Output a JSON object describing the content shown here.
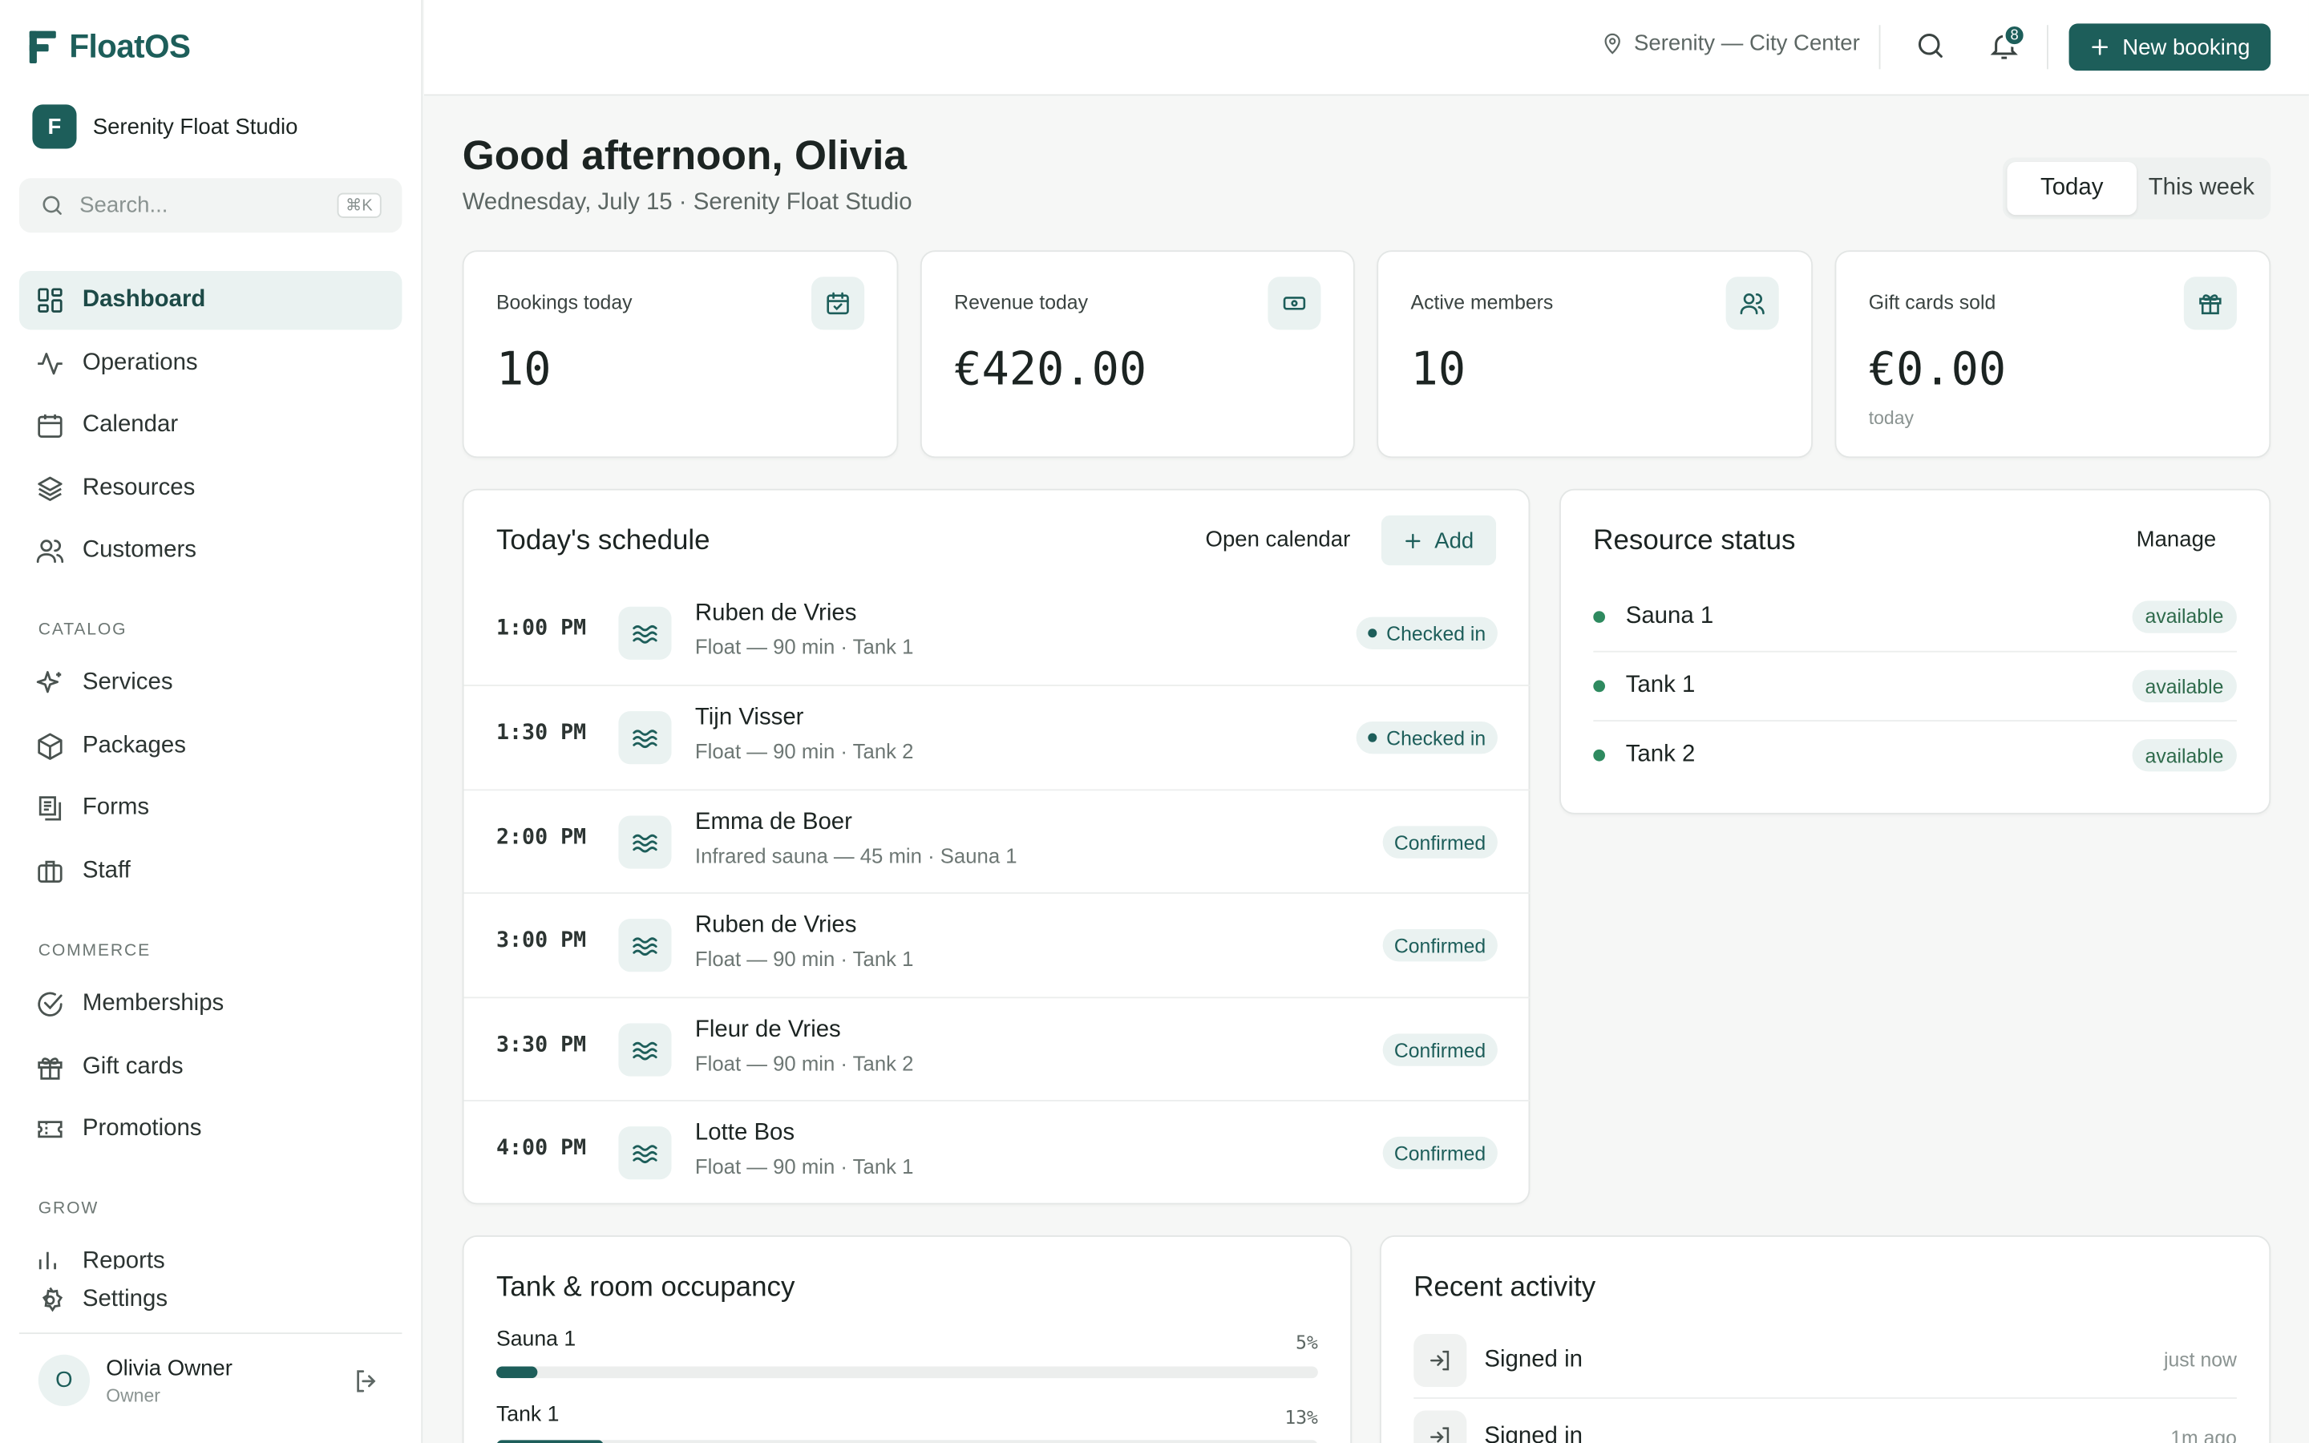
{
  "brand": {
    "name": "FloatOS"
  },
  "studio": {
    "badge": "F",
    "name": "Serenity Float Studio"
  },
  "search": {
    "placeholder": "Search...",
    "shortcut": "⌘K"
  },
  "nav": {
    "main": [
      {
        "label": "Dashboard",
        "icon": "dashboard-icon",
        "active": true
      },
      {
        "label": "Operations",
        "icon": "activity-icon"
      },
      {
        "label": "Calendar",
        "icon": "calendar-icon"
      },
      {
        "label": "Resources",
        "icon": "layers-icon"
      },
      {
        "label": "Customers",
        "icon": "users-icon"
      }
    ],
    "catalog_title": "CATALOG",
    "catalog": [
      {
        "label": "Services",
        "icon": "sparkles-icon"
      },
      {
        "label": "Packages",
        "icon": "package-icon"
      },
      {
        "label": "Forms",
        "icon": "forms-icon"
      },
      {
        "label": "Staff",
        "icon": "briefcase-icon"
      }
    ],
    "commerce_title": "COMMERCE",
    "commerce": [
      {
        "label": "Memberships",
        "icon": "check-circle-icon"
      },
      {
        "label": "Gift cards",
        "icon": "gift-icon"
      },
      {
        "label": "Promotions",
        "icon": "ticket-icon"
      }
    ],
    "grow_title": "GROW",
    "grow": [
      {
        "label": "Reports",
        "icon": "bar-chart-icon"
      }
    ],
    "settings": {
      "label": "Settings",
      "icon": "gear-icon"
    }
  },
  "user": {
    "initial": "O",
    "name": "Olivia Owner",
    "role": "Owner"
  },
  "topbar": {
    "location": "Serenity — City Center",
    "notifications": "8",
    "new_booking": "New booking"
  },
  "header": {
    "greeting": "Good afternoon, Olivia",
    "date": "Wednesday, July 15 · Serenity Float Studio"
  },
  "range": {
    "options": [
      "Today",
      "This week"
    ],
    "selected": "Today"
  },
  "stats": [
    {
      "label": "Bookings today",
      "value": "10",
      "sub": "",
      "icon": "calendar-check-icon"
    },
    {
      "label": "Revenue today",
      "value": "€420.00",
      "sub": "",
      "icon": "cash-icon"
    },
    {
      "label": "Active members",
      "value": "10",
      "sub": "",
      "icon": "users-icon"
    },
    {
      "label": "Gift cards sold",
      "value": "€0.00",
      "sub": "today",
      "icon": "gift-icon"
    }
  ],
  "schedule": {
    "title": "Today's schedule",
    "open_calendar": "Open calendar",
    "add": "Add",
    "rows": [
      {
        "time": "1:00 PM",
        "name": "Ruben de Vries",
        "detail": "Float — 90 min · Tank 1",
        "status": "Checked in",
        "checked": true
      },
      {
        "time": "1:30 PM",
        "name": "Tijn Visser",
        "detail": "Float — 90 min · Tank 2",
        "status": "Checked in",
        "checked": true
      },
      {
        "time": "2:00 PM",
        "name": "Emma de Boer",
        "detail": "Infrared sauna — 45 min · Sauna 1",
        "status": "Confirmed",
        "checked": false
      },
      {
        "time": "3:00 PM",
        "name": "Ruben de Vries",
        "detail": "Float — 90 min · Tank 1",
        "status": "Confirmed",
        "checked": false
      },
      {
        "time": "3:30 PM",
        "name": "Fleur de Vries",
        "detail": "Float — 90 min · Tank 2",
        "status": "Confirmed",
        "checked": false
      },
      {
        "time": "4:00 PM",
        "name": "Lotte Bos",
        "detail": "Float — 90 min · Tank 1",
        "status": "Confirmed",
        "checked": false
      }
    ]
  },
  "resources": {
    "title": "Resource status",
    "manage": "Manage",
    "items": [
      {
        "name": "Sauna 1",
        "status": "available"
      },
      {
        "name": "Tank 1",
        "status": "available"
      },
      {
        "name": "Tank 2",
        "status": "available"
      }
    ]
  },
  "occupancy": {
    "title": "Tank & room occupancy",
    "items": [
      {
        "name": "Sauna 1",
        "pct_label": "5%",
        "pct": 5
      },
      {
        "name": "Tank 1",
        "pct_label": "13%",
        "pct": 13
      }
    ]
  },
  "activity": {
    "title": "Recent activity",
    "items": [
      {
        "text": "Signed in",
        "time": "just now"
      },
      {
        "text": "Signed in",
        "time": "1m ago"
      }
    ]
  },
  "colors": {
    "accent": "#1d5e5a",
    "accent_soft": "#eaf2f1",
    "available": "#2e8a5f"
  }
}
